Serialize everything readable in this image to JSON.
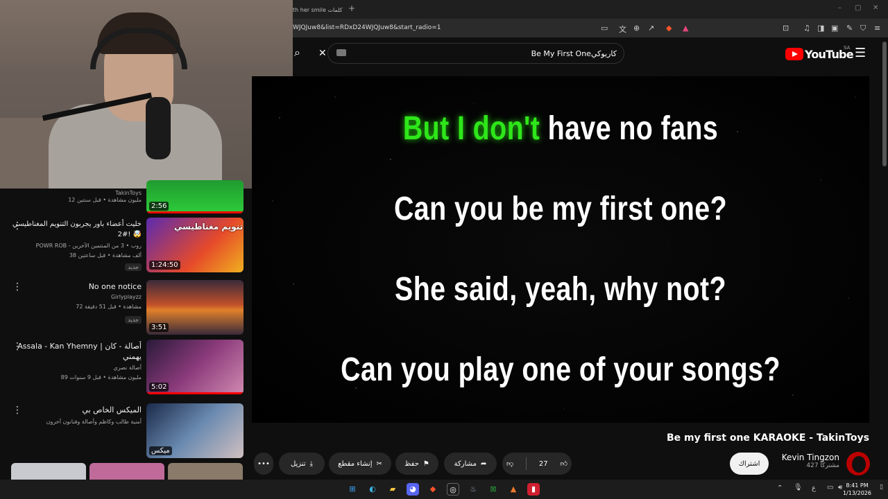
{
  "browser": {
    "tab_title": "th her smile كلمات",
    "new_tab": "+",
    "url": "WJQJuw8&list=RDxD24WJQJuw8&start_radio=1"
  },
  "header": {
    "search_query": "Be My First Oneكاريوكي",
    "logo_text": "YouTube",
    "logo_region": "SA"
  },
  "lyrics": {
    "line1_highlight": "But I don't",
    "line1_rest": " have no fans",
    "line2": "Can you be my first one?",
    "line3": "She said, yeah, why not?",
    "line4": "Can you play one of your songs?"
  },
  "video": {
    "title": "Be my first one KARAOKE - TakinToys",
    "channel": "Kevin Tingzon",
    "subscribers": "427 مشتركًا",
    "subscribe_label": "اشتراك",
    "likes": "27",
    "share_label": "مشاركة",
    "save_label": "حفظ",
    "clip_label": "إنشاء مقطع",
    "download_label": "تنزيل"
  },
  "sidebar": {
    "items": [
      {
        "title": "",
        "channel": "TakinToys",
        "meta": "12 مليون مشاهدة • قبل سنتين",
        "duration": "2:56",
        "badge": ""
      },
      {
        "title": "خليت أعضاء باور يجربون التنويم المغناطيسي 🤯 !#2",
        "channel": "POWR ROB - روب • 3 من المنتمين الآخرين",
        "meta": "38 ألف مشاهدة • قبل ساعتين",
        "duration": "1:24:50",
        "badge": "جديد",
        "thumb_text": "تنويم مغناطيسي"
      },
      {
        "title": "No one notice",
        "channel": "Girlyplayzz",
        "meta": "72 مشاهدة • قبل 51 دقيقة",
        "duration": "3:51",
        "badge": "جديد"
      },
      {
        "title": "Assala - Kan Yhemny | أصالة - كان يهمني",
        "channel": "أصالة نصري",
        "meta": "89 مليون مشاهدة • قبل 9 سنوات",
        "duration": "5:02",
        "badge": ""
      },
      {
        "title": "الميكس الخاص بي",
        "channel": "",
        "meta": "أمنية طالب وكاظم وأصالة وفنانون آخرون",
        "duration": "ميكس",
        "badge": ""
      }
    ]
  },
  "taskbar": {
    "time": "8:41 PM",
    "date": "1/13/2026",
    "lang": "ع"
  },
  "colors": {
    "highlight": "#2ee61a",
    "youtube_red": "#ff0000",
    "background": "#0f0f0f"
  }
}
